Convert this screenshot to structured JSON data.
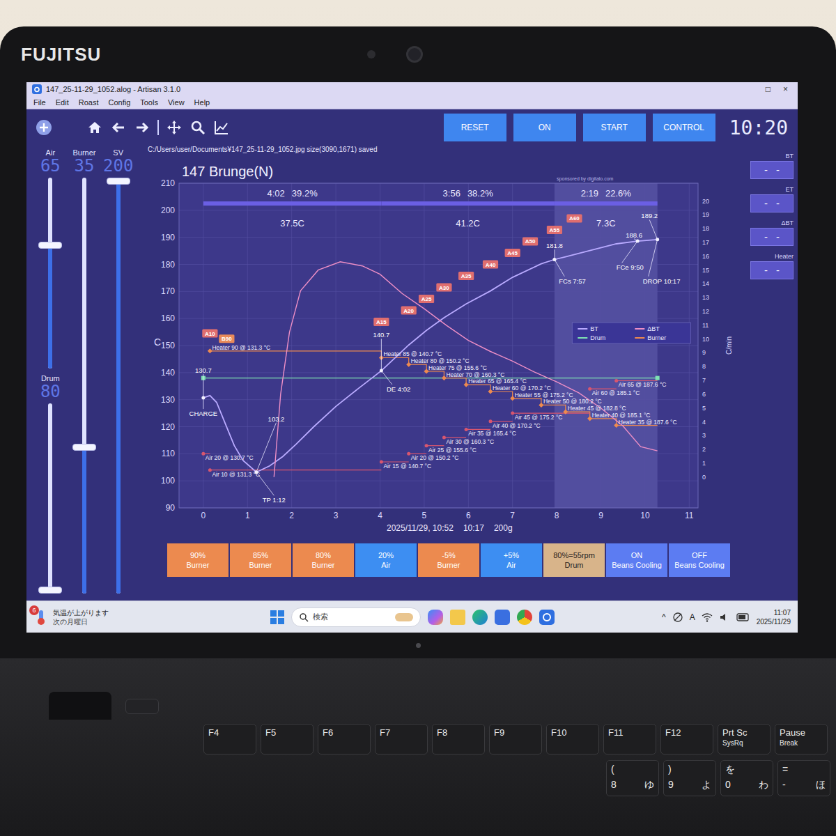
{
  "laptop": {
    "brand": "FUJITSU"
  },
  "window": {
    "title": "147_25-11-29_1052.alog - Artisan 3.1.0",
    "controls": [
      "□",
      "×"
    ]
  },
  "menu": [
    "File",
    "Edit",
    "Roast",
    "Config",
    "Tools",
    "View",
    "Help"
  ],
  "controls": [
    "RESET",
    "ON",
    "START",
    "CONTROL"
  ],
  "timer": "10:20",
  "slider_columns": [
    [
      {
        "name": "Air",
        "value": "65",
        "level": 0.65
      },
      {
        "name": "Drum",
        "value": "80",
        "level": 0
      }
    ],
    [
      {
        "name": "Burner",
        "value": "35",
        "level": 0.35
      }
    ],
    [
      {
        "name": "SV",
        "value": "200",
        "level": 1
      }
    ]
  ],
  "lcds": [
    {
      "label": "BT",
      "value": "- -"
    },
    {
      "label": "ET",
      "value": "- -"
    },
    {
      "label": "ΔBT",
      "value": "- -"
    },
    {
      "label": "Heater",
      "value": "- -"
    }
  ],
  "chart": {
    "saved_message": "C:/Users/user/Documents¥147_25-11-29_1052.jpg size(3090,1671) saved",
    "title": "147 Brunge(N)",
    "sponsor": "sponsored by digitalo.com",
    "y_label": "C",
    "y2_label": "C/min",
    "y_ticks": [
      "90",
      "100",
      "110",
      "120",
      "130",
      "140",
      "150",
      "160",
      "170",
      "180",
      "190",
      "200",
      "210"
    ],
    "y2_ticks": [
      "0",
      "1",
      "2",
      "3",
      "4",
      "5",
      "6",
      "7",
      "8",
      "9",
      "10",
      "11",
      "12",
      "13",
      "14",
      "15",
      "16",
      "17",
      "18",
      "19",
      "20"
    ],
    "x_ticks": [
      "0",
      "1",
      "2",
      "3",
      "4",
      "5",
      "6",
      "7",
      "8",
      "9",
      "10",
      "11"
    ],
    "phases": [
      {
        "time": "4:02",
        "percent": "39.2%",
        "ror": "37.5C",
        "start": 0,
        "end": 4.03
      },
      {
        "time": "3:56",
        "percent": "38.2%",
        "ror": "41.2C",
        "start": 4.03,
        "end": 7.95
      },
      {
        "time": "2:19",
        "percent": "22.6%",
        "ror": "7.3C",
        "start": 7.95,
        "end": 10.28
      }
    ],
    "footer": [
      "2025/11/29, 10:52",
      "10:17",
      "200g"
    ],
    "legend": [
      {
        "label": "BT",
        "color": "#b9aaff"
      },
      {
        "label": "ΔBT",
        "color": "#ee8fc6"
      },
      {
        "label": "Drum",
        "color": "#7fe3b4"
      },
      {
        "label": "Burner",
        "color": "#ee8a4f"
      }
    ],
    "drum": {
      "value": 80
    },
    "bt": [
      [
        0,
        130.7
      ],
      [
        0.15,
        131.5
      ],
      [
        0.3,
        129
      ],
      [
        0.5,
        121
      ],
      [
        0.7,
        113
      ],
      [
        0.9,
        107.5
      ],
      [
        1.2,
        103.2
      ],
      [
        1.5,
        105.5
      ],
      [
        1.8,
        109
      ],
      [
        2.1,
        113.5
      ],
      [
        2.5,
        120
      ],
      [
        3.0,
        127.5
      ],
      [
        3.5,
        134
      ],
      [
        4.03,
        140.7
      ],
      [
        4.65,
        150.2
      ],
      [
        5.05,
        155.6
      ],
      [
        5.45,
        160.3
      ],
      [
        5.95,
        165.4
      ],
      [
        6.5,
        170.2
      ],
      [
        7.0,
        175.2
      ],
      [
        7.65,
        180.2
      ],
      [
        7.95,
        181.8
      ],
      [
        8.2,
        182.8
      ],
      [
        8.75,
        185.1
      ],
      [
        9.35,
        187.6
      ],
      [
        9.83,
        188.6
      ],
      [
        10.28,
        189.2
      ]
    ],
    "delta_bt": [
      [
        1.6,
        0
      ],
      [
        1.75,
        6
      ],
      [
        1.95,
        10.5
      ],
      [
        2.2,
        13.5
      ],
      [
        2.6,
        15
      ],
      [
        3.1,
        15.6
      ],
      [
        3.6,
        15.3
      ],
      [
        4.0,
        14.7
      ],
      [
        4.5,
        13.3
      ],
      [
        5.0,
        12.2
      ],
      [
        5.5,
        11
      ],
      [
        6.0,
        9.9
      ],
      [
        6.5,
        9.1
      ],
      [
        7.0,
        8.4
      ],
      [
        7.5,
        7.6
      ],
      [
        8.0,
        6.9
      ],
      [
        8.5,
        6.1
      ],
      [
        9.0,
        5.0
      ],
      [
        9.5,
        3.7
      ],
      [
        9.9,
        2.2
      ],
      [
        10.28,
        1.9
      ]
    ],
    "events": [
      {
        "kind": "heater",
        "time": 0.15,
        "value": 90,
        "label": "Heater 90 @ 131.3 °C"
      },
      {
        "kind": "heater",
        "time": 4.03,
        "value": 85,
        "label": "Heater 85 @ 140.7 °C"
      },
      {
        "kind": "heater",
        "time": 4.65,
        "value": 80,
        "label": "Heater 80 @ 150.2 °C"
      },
      {
        "kind": "heater",
        "time": 5.05,
        "value": 75,
        "label": "Heater 75 @ 155.6 °C"
      },
      {
        "kind": "heater",
        "time": 5.45,
        "value": 70,
        "label": "Heater 70 @ 160.3 °C"
      },
      {
        "kind": "heater",
        "time": 5.95,
        "value": 65,
        "label": "Heater 65 @ 165.4 °C"
      },
      {
        "kind": "heater",
        "time": 6.5,
        "value": 60,
        "label": "Heater 60 @ 170.2 °C"
      },
      {
        "kind": "heater",
        "time": 7.0,
        "value": 55,
        "label": "Heater 55 @ 175.2 °C"
      },
      {
        "kind": "heater",
        "time": 7.65,
        "value": 50,
        "label": "Heater 50 @ 180.2 °C"
      },
      {
        "kind": "heater",
        "time": 8.2,
        "value": 45,
        "label": "Heater 45 @ 182.8 °C"
      },
      {
        "kind": "heater",
        "time": 8.75,
        "value": 40,
        "label": "Heater 40 @ 185.1 °C"
      },
      {
        "kind": "heater",
        "time": 9.35,
        "value": 35,
        "label": "Heater 35 @ 187.6 °C"
      },
      {
        "kind": "air",
        "time": 0,
        "value": 20,
        "label": "Air 20 @ 130.7 °C"
      },
      {
        "kind": "air",
        "time": 0.15,
        "value": 10,
        "label": "Air 10 @ 131.3 °C"
      },
      {
        "kind": "air",
        "time": 4.03,
        "value": 15,
        "label": "Air 15 @ 140.7 °C"
      },
      {
        "kind": "air",
        "time": 4.65,
        "value": 20,
        "label": "Air 20 @ 150.2 °C"
      },
      {
        "kind": "air",
        "time": 5.05,
        "value": 25,
        "label": "Air 25 @ 155.6 °C"
      },
      {
        "kind": "air",
        "time": 5.45,
        "value": 30,
        "label": "Air 30 @ 160.3 °C"
      },
      {
        "kind": "air",
        "time": 5.95,
        "value": 35,
        "label": "Air 35 @ 165.4 °C"
      },
      {
        "kind": "air",
        "time": 6.5,
        "value": 40,
        "label": "Air 40 @ 170.2 °C"
      },
      {
        "kind": "air",
        "time": 7.0,
        "value": 45,
        "label": "Air 45 @ 175.2 °C"
      },
      {
        "kind": "air",
        "time": 8.75,
        "value": 60,
        "label": "Air 60 @ 185.1 °C"
      },
      {
        "kind": "air",
        "time": 9.35,
        "value": 65,
        "label": "Air 65 @ 187.6 °C"
      }
    ],
    "flags": [
      {
        "label": "A10",
        "kind": "air",
        "time": 0.15,
        "value": 10
      },
      {
        "label": "B90",
        "kind": "burner",
        "time": 0.15,
        "value": 90
      },
      {
        "label": "A15",
        "kind": "air",
        "time": 4.03,
        "value": 15
      },
      {
        "label": "A20",
        "kind": "air",
        "time": 4.65,
        "value": 20
      },
      {
        "label": "A25",
        "kind": "air",
        "time": 5.05,
        "value": 25
      },
      {
        "label": "A30",
        "kind": "air",
        "time": 5.45,
        "value": 30
      },
      {
        "label": "A35",
        "kind": "air",
        "time": 5.95,
        "value": 35
      },
      {
        "label": "A40",
        "kind": "air",
        "time": 6.5,
        "value": 40
      },
      {
        "label": "A45",
        "kind": "air",
        "time": 7.0,
        "value": 45
      },
      {
        "label": "A50",
        "kind": "air",
        "time": 7.4,
        "value": 50
      },
      {
        "label": "A55",
        "kind": "air",
        "time": 7.95,
        "value": 55
      },
      {
        "label": "A60",
        "kind": "air",
        "time": 8.4,
        "value": 60
      }
    ],
    "points": [
      {
        "value": "130.7",
        "event": "CHARGE",
        "time": 0,
        "temp": 130.7
      },
      {
        "value": "103.2",
        "event": "TP 1:12",
        "time": 1.2,
        "temp": 103.2
      },
      {
        "value": "140.7",
        "event": "DE 4:02",
        "time": 4.03,
        "temp": 140.7
      },
      {
        "value": "181.8",
        "event": "FCs 7:57",
        "time": 7.95,
        "temp": 181.8
      },
      {
        "value": "188.6",
        "event": "FCe 9:50",
        "time": 9.83,
        "temp": 188.6
      },
      {
        "value": "189.2",
        "event": "DROP 10:17",
        "time": 10.28,
        "temp": 189.2
      }
    ]
  },
  "custom_buttons": [
    {
      "value": "90%",
      "label": "Burner",
      "color": "#ec8a4f"
    },
    {
      "value": "85%",
      "label": "Burner",
      "color": "#ec8a4f"
    },
    {
      "value": "80%",
      "label": "Burner",
      "color": "#ec8a4f"
    },
    {
      "value": "20%",
      "label": "Air",
      "color": "#3d8ef2"
    },
    {
      "value": "-5%",
      "label": "Burner",
      "color": "#ec8a4f"
    },
    {
      "value": "+5%",
      "label": "Air",
      "color": "#3d8ef2"
    },
    {
      "value": "80%=55rpm",
      "label": "Drum",
      "color": "#d8b48a"
    },
    {
      "value": "ON",
      "label": "Beans Cooling",
      "color": "#5c7cf2"
    },
    {
      "value": "OFF",
      "label": "Beans Cooling",
      "color": "#5c7cf2"
    }
  ],
  "taskbar": {
    "weather": {
      "badge": "6",
      "line1": "気温が上がります",
      "line2": "次の月曜日"
    },
    "search": "検索",
    "tray": [
      "^",
      "A"
    ],
    "time": "11:07",
    "date": "2025/11/29"
  },
  "keyboard": {
    "function_keys": [
      {
        "label": "F4",
        "sub": ""
      },
      {
        "label": "F5",
        "sub": ""
      },
      {
        "label": "F6",
        "sub": ""
      },
      {
        "label": "F7",
        "sub": ""
      },
      {
        "label": "F8",
        "sub": ""
      },
      {
        "label": "F9",
        "sub": ""
      },
      {
        "label": "F10",
        "sub": ""
      },
      {
        "label": "F11",
        "sub": ""
      },
      {
        "label": "F12",
        "sub": ""
      },
      {
        "label": "Prt Sc",
        "sub": "SysRq"
      },
      {
        "label": "Pause",
        "sub": "Break"
      }
    ],
    "number_keys": [
      {
        "shift": "(",
        "main": "8",
        "kana": "ゆ"
      },
      {
        "shift": ")",
        "main": "9",
        "kana": "よ"
      },
      {
        "shift": "を",
        "main": "0",
        "kana": "わ"
      },
      {
        "shift": "=",
        "main": "-",
        "kana": "ほ"
      }
    ]
  }
}
